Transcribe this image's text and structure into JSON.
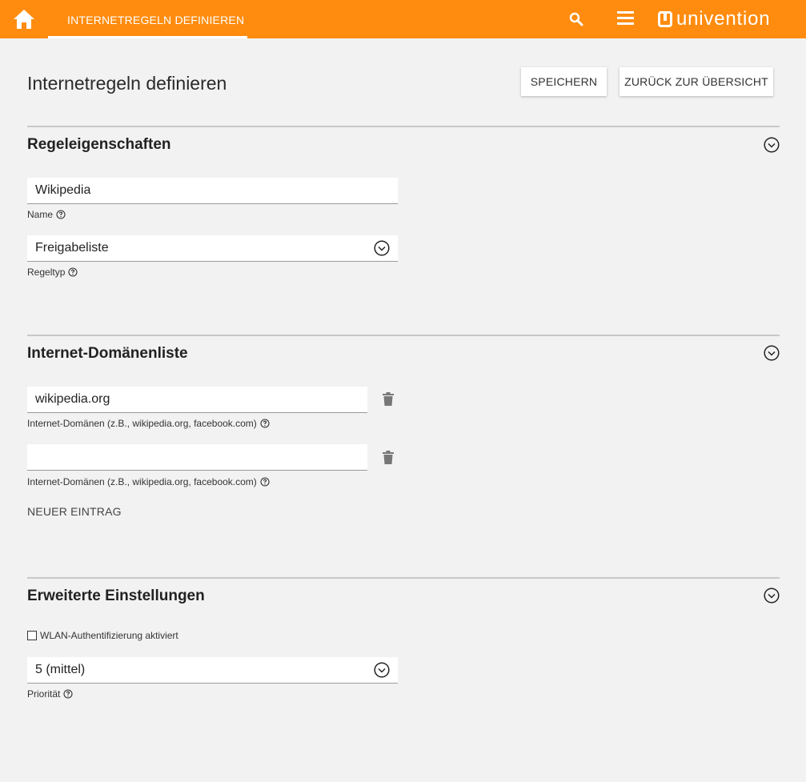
{
  "topbar": {
    "tab_label": "INTERNETREGELN DEFINIEREN",
    "brand": "univention",
    "accent_color": "#ff8c0f",
    "icons": [
      "home-icon",
      "search-icon",
      "menu-icon",
      "univention-logo-icon"
    ]
  },
  "page": {
    "title": "Internetregeln definieren",
    "save_label": "SPEICHERN",
    "back_label": "ZURÜCK ZUR ÜBERSICHT"
  },
  "rule_properties": {
    "title": "Regeleigenschaften",
    "name_value": "Wikipedia",
    "name_label": "Name",
    "type_value": "Freigabeliste",
    "type_label": "Regeltyp"
  },
  "domain_list": {
    "title": "Internet-Domänenliste",
    "entries": [
      {
        "value": "wikipedia.org",
        "label": "Internet-Domänen (z.B., wikipedia.org, facebook.com)"
      },
      {
        "value": "",
        "label": "Internet-Domänen (z.B., wikipedia.org, facebook.com)"
      }
    ],
    "new_entry_label": "NEUER EINTRAG"
  },
  "advanced": {
    "title": "Erweiterte Einstellungen",
    "wlan_label": "WLAN-Authentifizierung aktiviert",
    "wlan_checked": false,
    "priority_value": "5 (mittel)",
    "priority_label": "Priorität"
  }
}
